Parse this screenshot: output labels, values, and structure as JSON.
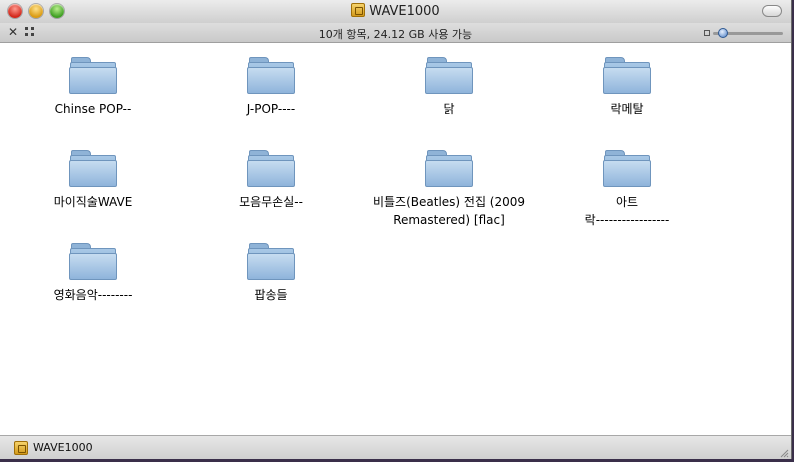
{
  "window": {
    "title": "WAVE1000"
  },
  "toolbar": {
    "status": "10개 항목, 24.12 GB 사용 가능"
  },
  "items": [
    {
      "label": "Chinse POP--"
    },
    {
      "label": "J-POP----"
    },
    {
      "label": "닭"
    },
    {
      "label": "락메탈"
    },
    {
      "label": "마이직술WAVE"
    },
    {
      "label": "모음무손실--"
    },
    {
      "label": "비틀즈(Beatles) 전집 (2009\nRemastered) [flac]"
    },
    {
      "label": "아트\n락-----------------"
    },
    {
      "label": "영화음악--------"
    },
    {
      "label": "팝송들"
    }
  ],
  "statusbar": {
    "path": "WAVE1000"
  },
  "colors": {
    "folder": "#9cbde0",
    "desktop": "#3a2f4a"
  }
}
